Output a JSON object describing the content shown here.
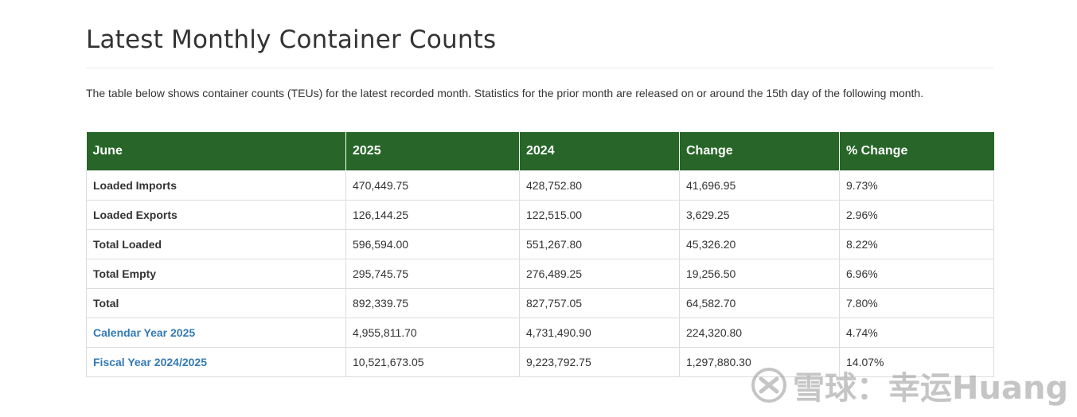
{
  "page": {
    "title": "Latest Monthly Container Counts",
    "intro": "The table below shows container counts (TEUs) for the latest recorded month. Statistics for the prior month are released on or around the 15th day of the following month."
  },
  "table": {
    "headers": [
      "June",
      "2025",
      "2024",
      "Change",
      "% Change"
    ],
    "rows": [
      {
        "label": "Loaded Imports",
        "is_link": false,
        "cells": [
          "470,449.75",
          "428,752.80",
          "41,696.95",
          "9.73%"
        ]
      },
      {
        "label": "Loaded Exports",
        "is_link": false,
        "cells": [
          "126,144.25",
          "122,515.00",
          "3,629.25",
          "2.96%"
        ]
      },
      {
        "label": "Total Loaded",
        "is_link": false,
        "cells": [
          "596,594.00",
          "551,267.80",
          "45,326.20",
          "8.22%"
        ]
      },
      {
        "label": "Total Empty",
        "is_link": false,
        "cells": [
          "295,745.75",
          "276,489.25",
          "19,256.50",
          "6.96%"
        ]
      },
      {
        "label": "Total",
        "is_link": false,
        "cells": [
          "892,339.75",
          "827,757.05",
          "64,582.70",
          "7.80%"
        ]
      },
      {
        "label": "Calendar Year 2025",
        "is_link": true,
        "cells": [
          "4,955,811.70",
          "4,731,490.90",
          "224,320.80",
          "4.74%"
        ]
      },
      {
        "label": "Fiscal Year 2024/2025",
        "is_link": true,
        "cells": [
          "10,521,673.05",
          "9,223,792.75",
          "1,297,880.30",
          "14.07%"
        ]
      }
    ]
  },
  "watermark": {
    "text": "雪球：幸运Huang",
    "icon": "snowball-logo-icon"
  },
  "colors": {
    "header_bg": "#276628",
    "link": "#337ab7",
    "text": "#333333",
    "border": "#dddddd"
  }
}
